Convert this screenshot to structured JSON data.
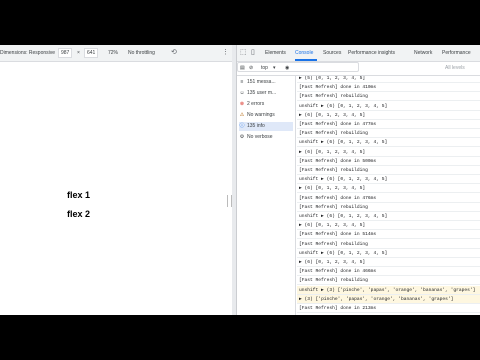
{
  "device_toolbar": {
    "dimensions_label": "Dimensions: Responsive",
    "width": "987",
    "height": "641",
    "zoom": "72%",
    "throttling": "No throttling"
  },
  "page": {
    "items": [
      "flex 1",
      "flex 2"
    ]
  },
  "devtools": {
    "tabs": [
      "Elements",
      "Console",
      "Sources",
      "Performance insights",
      "Network",
      "Performance"
    ],
    "active_tab": "Console",
    "context": "top",
    "levels": "All levels",
    "sidebar": [
      {
        "icon": "list-icon",
        "glyph": "≡",
        "label": "151 messa..."
      },
      {
        "icon": "user-icon",
        "glyph": "☺",
        "label": "135 user m..."
      },
      {
        "icon": "error-icon",
        "glyph": "⊗",
        "label": "2 errors"
      },
      {
        "icon": "warning-icon",
        "glyph": "⚠",
        "label": "No warnings"
      },
      {
        "icon": "info-icon",
        "glyph": "ⓘ",
        "label": "135 info"
      },
      {
        "icon": "verbose-icon",
        "glyph": "⚙",
        "label": "No verbose"
      }
    ]
  },
  "console": [
    {
      "kind": "log",
      "text": "▶ (5) [0, 1, 2, 3, 4, 5]"
    },
    {
      "kind": "log",
      "text": "[Fast Refresh] done in 410ms"
    },
    {
      "kind": "log",
      "text": "[Fast Refresh] rebuilding"
    },
    {
      "kind": "log",
      "text": "unshift ▶ (6) [0, 1, 2, 3, 4, 5]"
    },
    {
      "kind": "log",
      "text": "        ▶ (6) [0, 1, 2, 3, 4, 5]"
    },
    {
      "kind": "log",
      "text": "[Fast Refresh] done in 477ms"
    },
    {
      "kind": "log",
      "text": "[Fast Refresh] rebuilding"
    },
    {
      "kind": "log",
      "text": "unshift ▶ (6) [0, 1, 2, 3, 4, 5]"
    },
    {
      "kind": "log",
      "text": "        ▶ (6) [0, 1, 2, 3, 4, 5]"
    },
    {
      "kind": "log",
      "text": "[Fast Refresh] done in 500ms"
    },
    {
      "kind": "log",
      "text": "[Fast Refresh] rebuilding"
    },
    {
      "kind": "log",
      "text": "unshift ▶ (6) [0, 1, 2, 3, 4, 5]"
    },
    {
      "kind": "log",
      "text": "        ▶ (6) [0, 1, 2, 3, 4, 5]"
    },
    {
      "kind": "log",
      "text": "[Fast Refresh] done in 476ms"
    },
    {
      "kind": "log",
      "text": "[Fast Refresh] rebuilding"
    },
    {
      "kind": "log",
      "text": "unshift ▶ (6) [0, 1, 2, 3, 4, 5]"
    },
    {
      "kind": "log",
      "text": "        ▶ (6) [0, 1, 2, 3, 4, 5]"
    },
    {
      "kind": "log",
      "text": "[Fast Refresh] done in 514ms"
    },
    {
      "kind": "log",
      "text": "[Fast Refresh] rebuilding"
    },
    {
      "kind": "log",
      "text": "unshift ▶ (6) [0, 1, 2, 3, 4, 5]"
    },
    {
      "kind": "log",
      "text": "        ▶ (6) [0, 1, 2, 3, 4, 5]"
    },
    {
      "kind": "log",
      "text": "[Fast Refresh] done in 466ms"
    },
    {
      "kind": "log",
      "text": "[Fast Refresh] rebuilding"
    },
    {
      "kind": "warn",
      "text": "unshift ▶ (3) ['pinche', 'papas', 'orange', 'bananas', 'grapes']"
    },
    {
      "kind": "warn",
      "text": "        ▶ (3) ['pinche', 'papas', 'orange', 'bananas', 'grapes']"
    },
    {
      "kind": "log",
      "text": "[Fast Refresh] done in 213ms"
    }
  ]
}
